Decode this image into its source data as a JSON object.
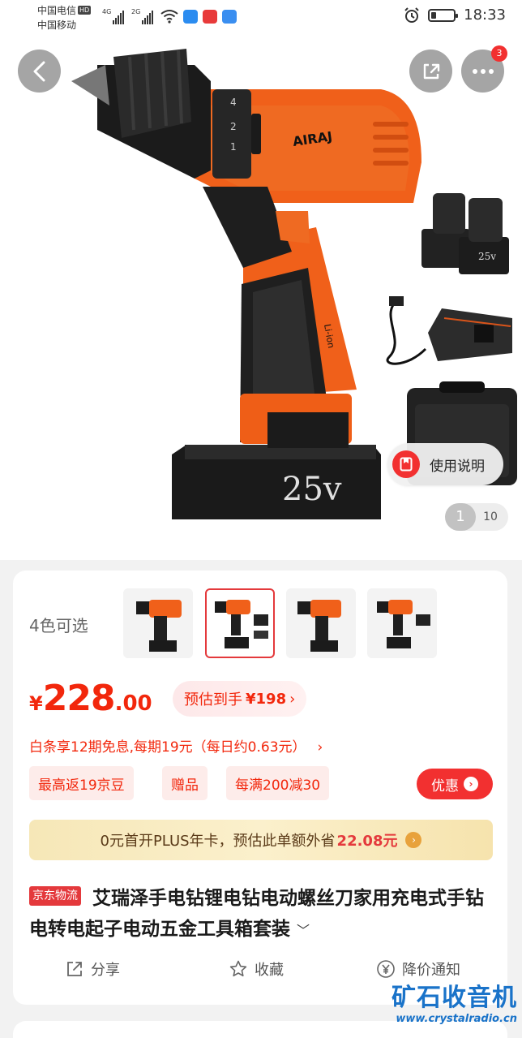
{
  "status_bar": {
    "carrier1": "中国电信",
    "hd": "HD",
    "carrier2": "中国移动",
    "sig1": "4G",
    "sig2": "2G",
    "time": "18:33"
  },
  "hero": {
    "message_count": "3",
    "manual_label": "使用说明",
    "pager_current": "1",
    "pager_total": "10",
    "battery_text": "25v",
    "brand_text": "AIRAJ",
    "handle_text": "Li-ion",
    "colors": {
      "orange": "#f0601a",
      "dark": "#1e1e1e"
    }
  },
  "product": {
    "colors_label": "4色可选",
    "thumbnails": [
      "color-1",
      "color-2",
      "color-3",
      "color-4"
    ],
    "selected_thumbnail": 1,
    "price_symbol": "¥",
    "price_int": "228",
    "price_dec": ".00",
    "estimate_label": "预估到手",
    "estimate_amount": "¥198",
    "estimate_arrow": "›",
    "installment": "白条享12期免息,每期19元（每日约0.63元）",
    "installment_arrow": "›",
    "chips": [
      "最高返19京豆",
      "赠品",
      "每满200减30"
    ],
    "coupon_label": "优惠",
    "plus_text": "0元首开PLUS年卡，预估此单额外省",
    "plus_amount": "22.08元",
    "logistics_tag": "京东物流",
    "title": "艾瑞泽手电钻锂电钻电动螺丝刀家用充电式手钻电转电起子电动五金工具箱套装",
    "actions": {
      "share": "分享",
      "favorite": "收藏",
      "price_alert": "降价通知"
    },
    "accent_color": "#f2270c"
  },
  "watermark": {
    "title": "矿石收音机",
    "url": "www.crystalradio.cn"
  }
}
